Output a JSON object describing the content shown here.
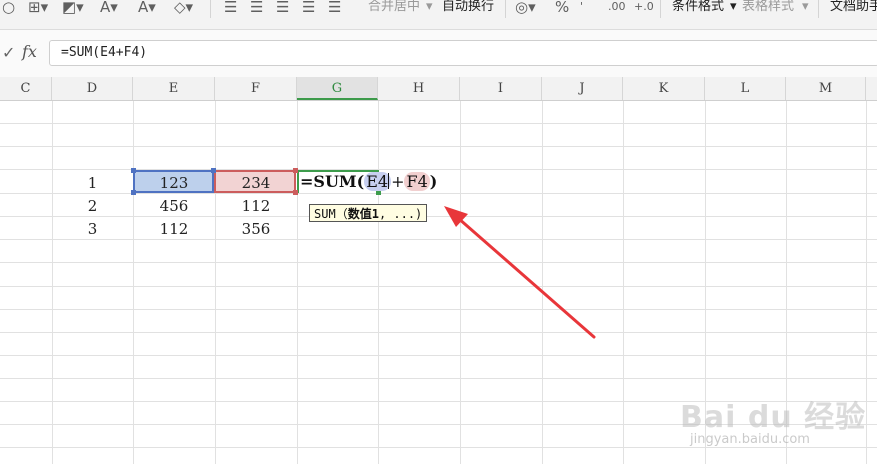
{
  "toolbar": {
    "merge_center": "合并居中",
    "auto_wrap": "自动换行",
    "percent": "%",
    "cond_format": "条件格式",
    "table_style": "表格样式",
    "doc_helper": "文档助手"
  },
  "formula_bar": {
    "check_icon": "✓",
    "fx_label": "fx",
    "content": "=SUM(E4+F4)"
  },
  "columns": [
    "C",
    "D",
    "E",
    "F",
    "G",
    "H",
    "I",
    "J",
    "K",
    "L",
    "M"
  ],
  "active_column": "G",
  "rows": [
    {
      "d": "1",
      "e": "123",
      "f": "234"
    },
    {
      "d": "2",
      "e": "456",
      "f": "112"
    },
    {
      "d": "3",
      "e": "112",
      "f": "356"
    }
  ],
  "edit_cell": {
    "prefix": "=SUM(",
    "ref1": "E4",
    "op": "+",
    "ref2": "F4",
    "suffix": ")"
  },
  "tooltip": {
    "func": "SUM",
    "open": "（",
    "arg": "数值1",
    "rest": ", ...)"
  },
  "watermark": {
    "main": "Bai du 经验",
    "sub": "jingyan.baidu.com"
  },
  "colors": {
    "ref1": "#4f72c2",
    "ref2": "#cc5d5d",
    "active": "#3d9c4c",
    "arrow": "#e8363a"
  }
}
